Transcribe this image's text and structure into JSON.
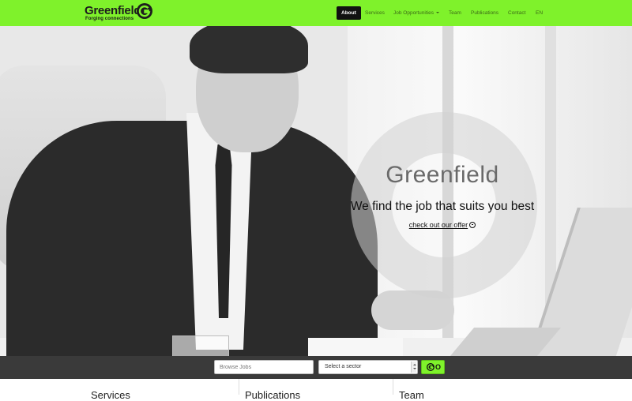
{
  "brand": {
    "name": "Greenfield",
    "tagline": "Forging connections"
  },
  "nav": {
    "items": [
      {
        "label": "About",
        "active": true
      },
      {
        "label": "Services",
        "active": false
      },
      {
        "label": "Job Opportunities",
        "active": false,
        "dropdown": true
      },
      {
        "label": "Team",
        "active": false
      },
      {
        "label": "Publications",
        "active": false
      },
      {
        "label": "Contact",
        "active": false
      },
      {
        "label": "EN",
        "active": false
      }
    ]
  },
  "hero": {
    "title": "Greenfield",
    "subtitle": "We find the job that suits you best",
    "link": "check out our offer"
  },
  "search": {
    "placeholder": "Browse Jobs",
    "sector_selected": "Select a sector",
    "go_label": "O"
  },
  "sections": [
    {
      "title": "Services"
    },
    {
      "title": "Publications"
    },
    {
      "title": "Team"
    }
  ],
  "colors": {
    "brand_green": "#7ff22b",
    "nav_active_bg": "#111111",
    "search_bar_bg": "#3a3a3a"
  },
  "icons": {
    "logo": "g-circle-logo",
    "link": "arrow-circle-icon",
    "dropdown": "caret-down-icon"
  }
}
